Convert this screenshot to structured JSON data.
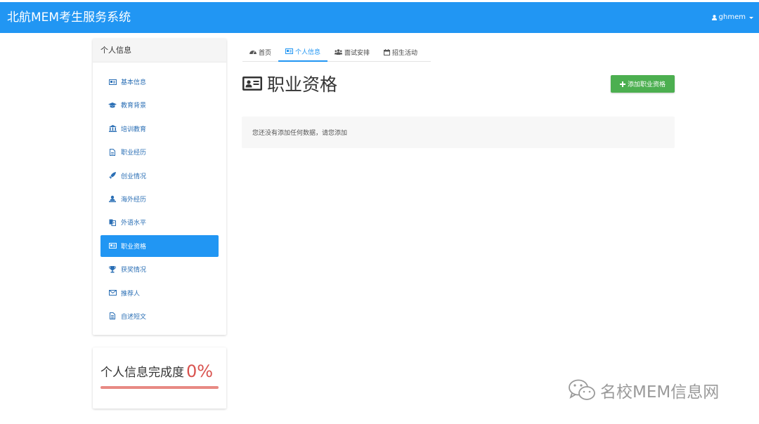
{
  "app": {
    "title": "北航MEM考生服务系统",
    "username": "ghmem"
  },
  "sidebar": {
    "heading": "个人信息",
    "items": [
      {
        "label": "基本信息",
        "icon": "id-card-icon"
      },
      {
        "label": "教育背景",
        "icon": "graduation-cap-icon"
      },
      {
        "label": "培训教育",
        "icon": "institution-icon"
      },
      {
        "label": "职业经历",
        "icon": "document-icon"
      },
      {
        "label": "创业情况",
        "icon": "rocket-icon"
      },
      {
        "label": "海外经历",
        "icon": "travel-icon"
      },
      {
        "label": "外语水平",
        "icon": "language-icon"
      },
      {
        "label": "职业资格",
        "icon": "id-card-icon",
        "active": true
      },
      {
        "label": "获奖情况",
        "icon": "trophy-icon"
      },
      {
        "label": "推荐人",
        "icon": "envelope-icon"
      },
      {
        "label": "自述短文",
        "icon": "file-text-icon"
      }
    ]
  },
  "completion": {
    "label": "个人信息完成度",
    "value": "0%",
    "progress_percent": 0
  },
  "tabs": [
    {
      "label": "首页",
      "icon": "dashboard-icon"
    },
    {
      "label": "个人信息",
      "icon": "id-card-icon",
      "active": true
    },
    {
      "label": "面试安排",
      "icon": "users-icon"
    },
    {
      "label": "招生活动",
      "icon": "calendar-icon"
    }
  ],
  "main": {
    "title": "职业资格",
    "add_button": "添加职业资格",
    "empty_message": "您还没有添加任何数据，请您添加"
  },
  "watermark": {
    "text": "名校MEM信息网"
  },
  "colors": {
    "primary": "#2196f3",
    "success": "#4caf50",
    "danger": "#d9534f"
  }
}
